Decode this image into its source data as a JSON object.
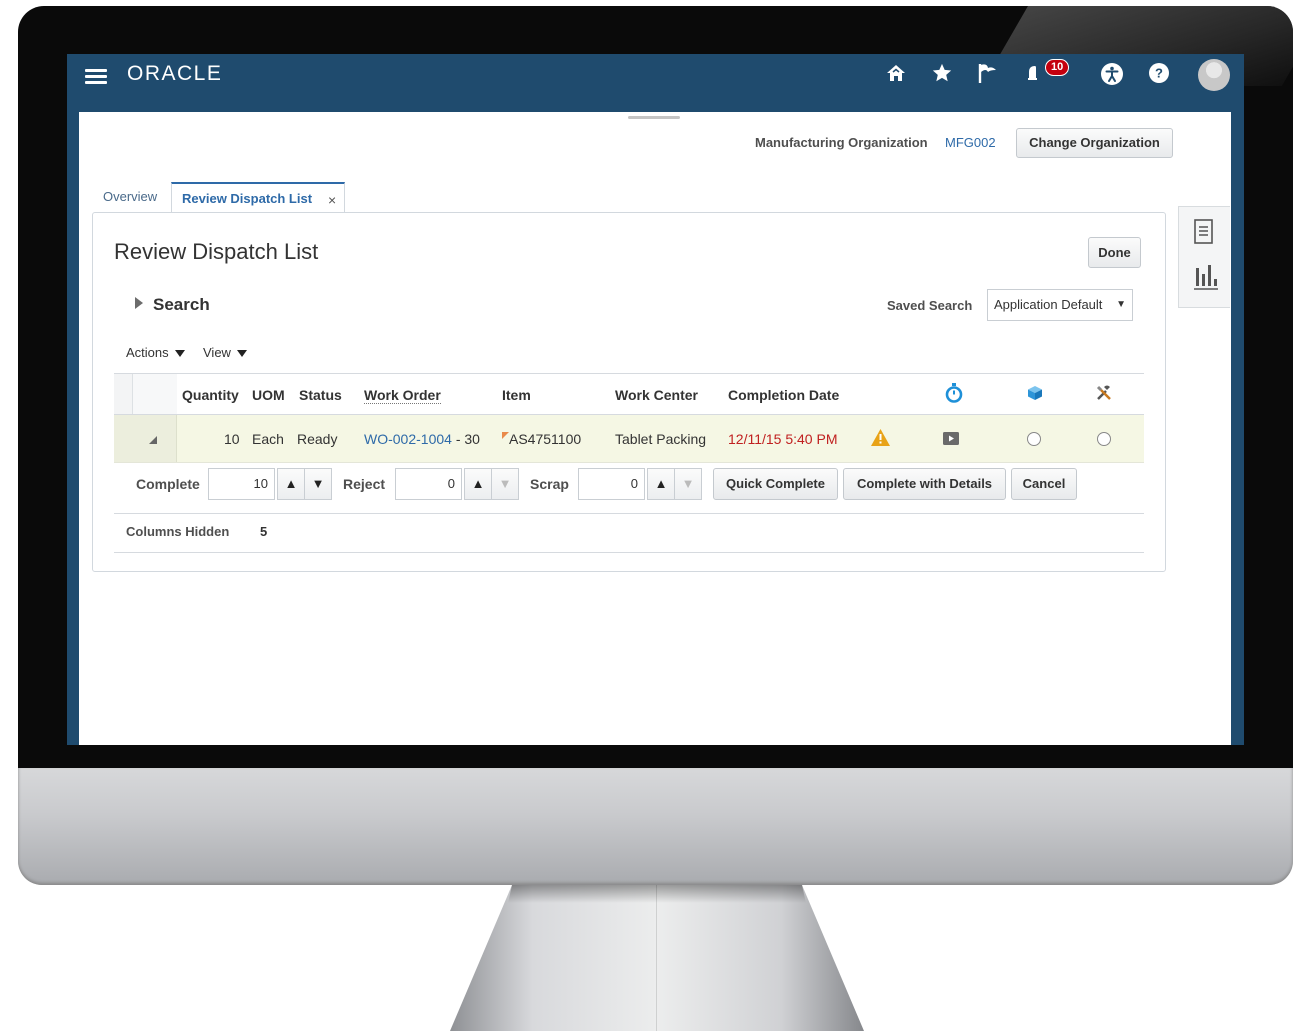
{
  "app": {
    "brand": "ORACLE",
    "notifications_count": "10"
  },
  "header": {
    "org_label": "Manufacturing Organization",
    "org_value": "MFG002",
    "change_org_button": "Change Organization"
  },
  "tabs": [
    {
      "label": "Overview",
      "active": false
    },
    {
      "label": "Review Dispatch List",
      "active": true,
      "close": "×"
    }
  ],
  "page": {
    "title": "Review Dispatch List",
    "done_button": "Done",
    "search_label": "Search",
    "saved_search_label": "Saved Search",
    "saved_search_value": "Application Default",
    "menus": {
      "actions": "Actions",
      "view": "View"
    }
  },
  "table": {
    "columns": [
      "Quantity",
      "UOM",
      "Status",
      "Work Order",
      "Item",
      "Work Center",
      "Completion Date"
    ],
    "icon_columns": [
      "stopwatch-icon",
      "cube-icon",
      "tools-icon"
    ],
    "rows": [
      {
        "quantity": "10",
        "uom": "Each",
        "status": "Ready",
        "work_order": "WO-002-1004",
        "operation": "- 30",
        "item": "AS4751100",
        "work_center": "Tablet Packing",
        "completion_date": "12/11/15 5:40 PM"
      }
    ]
  },
  "controls": {
    "complete_label": "Complete",
    "complete_value": "10",
    "reject_label": "Reject",
    "reject_value": "0",
    "scrap_label": "Scrap",
    "scrap_value": "0",
    "quick_complete": "Quick Complete",
    "complete_with_details": "Complete with Details",
    "cancel": "Cancel"
  },
  "footer": {
    "columns_hidden_label": "Columns Hidden",
    "columns_hidden_value": "5"
  },
  "colors": {
    "header_bg": "#1f4b6e",
    "link": "#2e6aa8",
    "alert_red": "#c02020",
    "warning": "#e8a317",
    "row_highlight": "#f5f7e4"
  }
}
